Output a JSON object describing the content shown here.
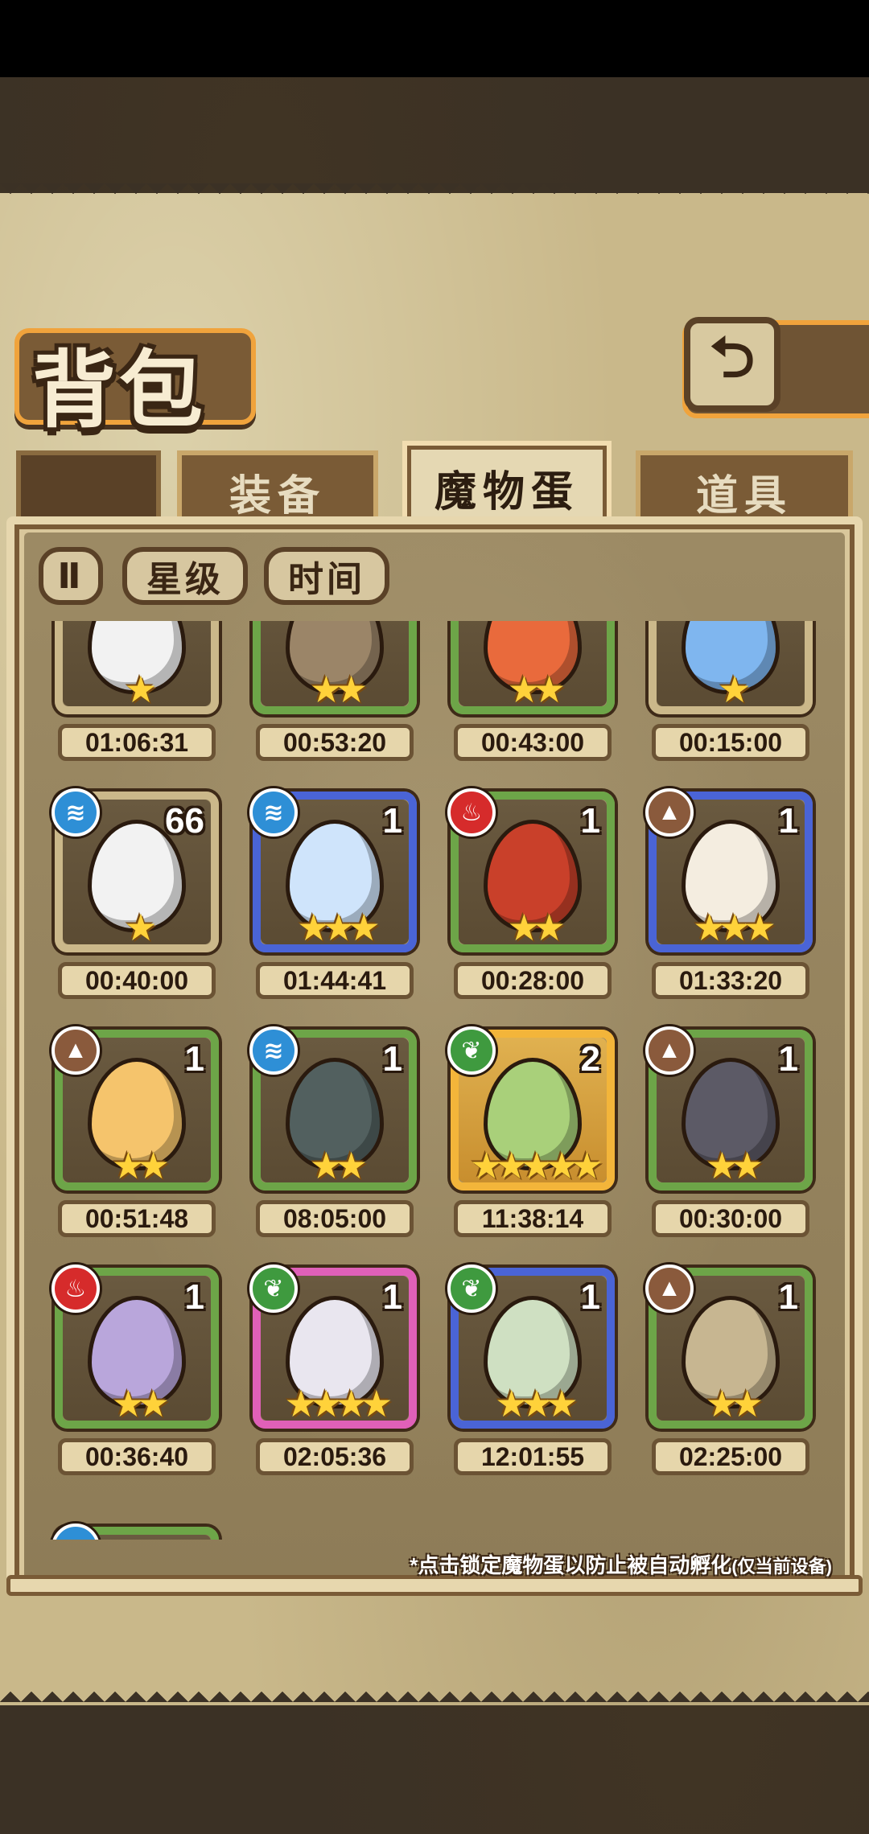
{
  "screen": {
    "title": "背包",
    "back_icon": "⮌"
  },
  "tabs": [
    {
      "label": "装备"
    },
    {
      "label": "魔物蛋",
      "active": true
    },
    {
      "label": "道具"
    }
  ],
  "filters": {
    "sort_icon": "Ⅱ",
    "star_label": "星级",
    "time_label": "时间"
  },
  "hint": {
    "main": "*点击锁定魔物蛋以防止被自动孵化",
    "note": "(仅当前设备)"
  },
  "cards": [
    {
      "stars": "★",
      "timer": "01:06:31",
      "count": "",
      "element": "",
      "rarity": "r1",
      "color": "#f2f2f2"
    },
    {
      "stars": "★★",
      "timer": "00:53:20",
      "count": "",
      "element": "",
      "rarity": "r2",
      "color": "#9b8568"
    },
    {
      "stars": "★★",
      "timer": "00:43:00",
      "count": "",
      "element": "",
      "rarity": "r2",
      "color": "#e96a3c"
    },
    {
      "stars": "★",
      "timer": "00:15:00",
      "count": "",
      "element": "",
      "rarity": "r1",
      "color": "#7fb6ef"
    },
    {
      "stars": "★",
      "timer": "00:40:00",
      "count": "66",
      "element": "water",
      "element_icon": "≋",
      "rarity": "r1",
      "color": "#f2f2f2"
    },
    {
      "stars": "★★★",
      "timer": "01:44:41",
      "count": "1",
      "element": "water",
      "element_icon": "≋",
      "rarity": "r3",
      "color": "#cfe4fb"
    },
    {
      "stars": "★★",
      "timer": "00:28:00",
      "count": "1",
      "element": "fire",
      "element_icon": "♨",
      "rarity": "r2",
      "color": "#c9402a"
    },
    {
      "stars": "★★★",
      "timer": "01:33:20",
      "count": "1",
      "element": "earth",
      "element_icon": "▲",
      "rarity": "r3",
      "color": "#f4ede0"
    },
    {
      "stars": "★★",
      "timer": "00:51:48",
      "count": "1",
      "element": "earth",
      "element_icon": "▲",
      "rarity": "r2",
      "color": "#f5c46c"
    },
    {
      "stars": "★★",
      "timer": "08:05:00",
      "count": "1",
      "element": "water",
      "element_icon": "≋",
      "rarity": "r2",
      "color": "#52605f"
    },
    {
      "stars": "★★★★★",
      "timer": "11:38:14",
      "count": "2",
      "element": "grass",
      "element_icon": "❦",
      "rarity": "r5",
      "color": "#a9d07a"
    },
    {
      "stars": "★★",
      "timer": "00:30:00",
      "count": "1",
      "element": "earth",
      "element_icon": "▲",
      "rarity": "r2",
      "color": "#5c5a66"
    },
    {
      "stars": "★★",
      "timer": "00:36:40",
      "count": "1",
      "element": "fire",
      "element_icon": "♨",
      "rarity": "r2",
      "color": "#b9a6db"
    },
    {
      "stars": "★★★★",
      "timer": "02:05:36",
      "count": "1",
      "element": "grass",
      "element_icon": "❦",
      "rarity": "r4",
      "color": "#e9e6ef"
    },
    {
      "stars": "★★★",
      "timer": "12:01:55",
      "count": "1",
      "element": "grass",
      "element_icon": "❦",
      "rarity": "r3",
      "color": "#cfe0c2"
    },
    {
      "stars": "★★",
      "timer": "02:25:00",
      "count": "1",
      "element": "earth",
      "element_icon": "▲",
      "rarity": "r2",
      "color": "#c7b691"
    }
  ]
}
